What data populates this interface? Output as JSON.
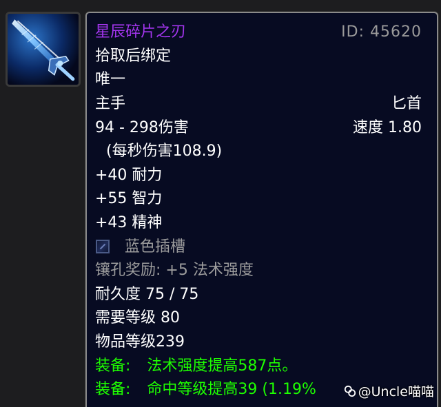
{
  "item": {
    "name": "星辰碎片之刃",
    "id_label": "ID: 45620",
    "bind": "拾取后绑定",
    "unique": "唯一",
    "slot": "主手",
    "weapon_type": "匕首",
    "damage": "94 - 298伤害",
    "speed": "速度 1.80",
    "dps": "(每秒伤害108.9)",
    "stats": [
      "+40 耐力",
      "+55 智力",
      "+43 精神"
    ],
    "socket": "蓝色插槽",
    "socket_bonus": "镶孔奖励: +5 法术强度",
    "durability": "耐久度 75 / 75",
    "required_level": "需要等级 80",
    "item_level": "物品等级239",
    "equip_effects": [
      {
        "label": "装备:",
        "text": "法术强度提高587点。"
      },
      {
        "label": "装备:",
        "text": "命中等级提高39 (1.19%"
      }
    ]
  },
  "watermark": {
    "text": "@Uncle喵喵"
  },
  "icons": {
    "item_icon": "dagger-icon",
    "socket_icon": "blue-socket-icon",
    "watermark_logo": "toutiao-logo-icon"
  },
  "colors": {
    "epic_purple": "#a335ee",
    "uncommon_green": "#1eff00",
    "gray_text": "#9d9d9d",
    "tooltip_bg": "#070b22"
  }
}
